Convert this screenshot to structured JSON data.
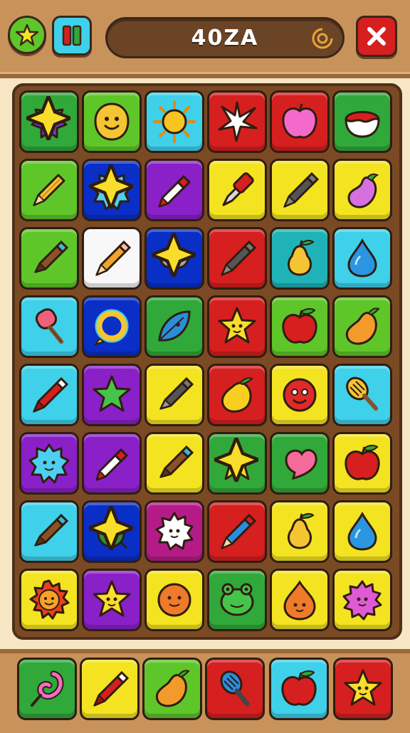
{
  "header": {
    "title": "40ZA",
    "star_button_icon": "star-icon",
    "pause_button_icon": "pause-icon",
    "target_icon": "target-icon",
    "close_button_icon": "close-icon"
  },
  "colors": {
    "green": "#31a83a",
    "lime": "#5fc62a",
    "cyan": "#3fd0ea",
    "red": "#d61f1f",
    "yellow": "#f4e321",
    "blue": "#0a2fc6",
    "purple": "#8a20c8",
    "magenta": "#b51b86",
    "white": "#f8f8f8",
    "teal": "#1fb3b7"
  },
  "board": {
    "rows": [
      [
        {
          "bg": "green",
          "icon": "purple-blob-icon",
          "spark": true
        },
        {
          "bg": "lime",
          "icon": "smiley-blob-icon"
        },
        {
          "bg": "cyan",
          "icon": "sun-icon"
        },
        {
          "bg": "red",
          "icon": "white-star-burst-icon"
        },
        {
          "bg": "red",
          "icon": "pink-apple-icon"
        },
        {
          "bg": "green",
          "icon": "red-bowl-icon"
        }
      ],
      [
        {
          "bg": "lime",
          "icon": "pencil-icon"
        },
        {
          "bg": "blue",
          "icon": "cyan-blob-icon",
          "spark": true
        },
        {
          "bg": "purple",
          "icon": "red-pen-icon"
        },
        {
          "bg": "yellow",
          "icon": "red-marker-icon"
        },
        {
          "bg": "yellow",
          "icon": "grey-crayon-icon"
        },
        {
          "bg": "yellow",
          "icon": "eggplant-icon"
        }
      ],
      [
        {
          "bg": "lime",
          "icon": "brown-marker-icon"
        },
        {
          "bg": "white",
          "icon": "orange-pencil-icon"
        },
        {
          "bg": "blue",
          "icon": "grey-ghost-icon",
          "spark": true
        },
        {
          "bg": "red",
          "icon": "grey-crayon-icon"
        },
        {
          "bg": "teal",
          "icon": "yellow-pear-icon"
        },
        {
          "bg": "cyan",
          "icon": "water-drop-icon"
        }
      ],
      [
        {
          "bg": "cyan",
          "icon": "ice-pop-icon"
        },
        {
          "bg": "blue",
          "icon": "yellow-ring-icon"
        },
        {
          "bg": "green",
          "icon": "blue-leaf-icon"
        },
        {
          "bg": "red",
          "icon": "yellow-star-icon"
        },
        {
          "bg": "lime",
          "icon": "red-apple-icon"
        },
        {
          "bg": "lime",
          "icon": "mango-icon"
        }
      ],
      [
        {
          "bg": "cyan",
          "icon": "red-crayon-icon"
        },
        {
          "bg": "purple",
          "icon": "green-star-icon"
        },
        {
          "bg": "yellow",
          "icon": "grey-marker-icon"
        },
        {
          "bg": "red",
          "icon": "yellow-lemon-icon"
        },
        {
          "bg": "yellow",
          "icon": "red-face-ball-icon"
        },
        {
          "bg": "cyan",
          "icon": "whisk-icon"
        }
      ],
      [
        {
          "bg": "purple",
          "icon": "cyan-blob-icon"
        },
        {
          "bg": "purple",
          "icon": "red-pen-icon"
        },
        {
          "bg": "yellow",
          "icon": "brown-marker-icon"
        },
        {
          "bg": "green",
          "icon": "yellow-star-icon",
          "spark": true
        },
        {
          "bg": "green",
          "icon": "pink-heart-icon"
        },
        {
          "bg": "yellow",
          "icon": "red-apple-icon"
        }
      ],
      [
        {
          "bg": "cyan",
          "icon": "brown-marker-icon"
        },
        {
          "bg": "blue",
          "icon": "green-bomb-icon",
          "spark": true
        },
        {
          "bg": "magenta",
          "icon": "white-blob-icon"
        },
        {
          "bg": "red",
          "icon": "blue-crayon-icon"
        },
        {
          "bg": "yellow",
          "icon": "yellow-pear-icon"
        },
        {
          "bg": "yellow",
          "icon": "water-drop-icon"
        }
      ],
      [
        {
          "bg": "yellow",
          "icon": "red-sun-face-icon"
        },
        {
          "bg": "purple",
          "icon": "yellow-star-icon"
        },
        {
          "bg": "yellow",
          "icon": "orange-face-ball-icon"
        },
        {
          "bg": "green",
          "icon": "green-frog-icon"
        },
        {
          "bg": "yellow",
          "icon": "orange-drop-face-icon"
        },
        {
          "bg": "yellow",
          "icon": "pink-blob-icon"
        }
      ]
    ]
  },
  "tray": {
    "items": [
      {
        "bg": "green",
        "icon": "pink-hook-icon"
      },
      {
        "bg": "yellow",
        "icon": "red-crayon-icon"
      },
      {
        "bg": "lime",
        "icon": "mango-icon"
      },
      {
        "bg": "red",
        "icon": "blue-whisk-icon"
      },
      {
        "bg": "cyan",
        "icon": "red-apple-icon"
      },
      {
        "bg": "red",
        "icon": "yellow-star-icon"
      }
    ]
  }
}
